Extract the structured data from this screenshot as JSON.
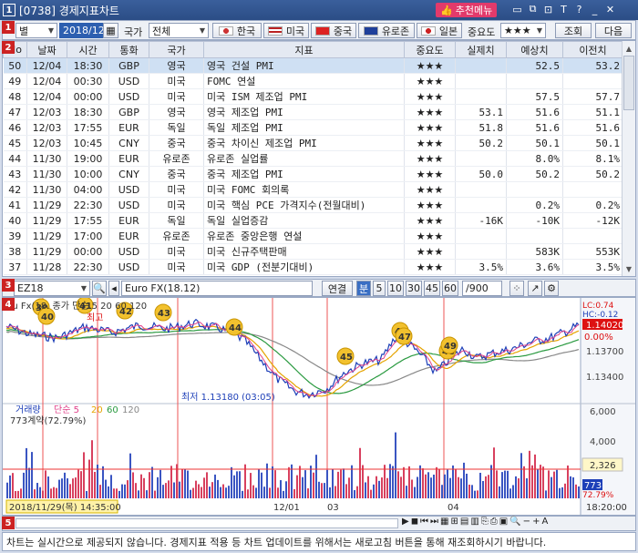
{
  "window": {
    "number": "1",
    "title": "[0738] 경제지표차트",
    "recommend_label": "추천메뉴",
    "icons": [
      "window-icon",
      "restore-icon",
      "pin-icon",
      "text-size-icon",
      "help-icon",
      "minimize-icon",
      "close-icon"
    ]
  },
  "toolbar": {
    "period_value": "별",
    "date_value": "2018/12/04",
    "country_label": "국가",
    "country_value": "전체",
    "countries": [
      {
        "label": "한국",
        "icon": "korea-flag-icon"
      },
      {
        "label": "미국",
        "icon": "usa-flag-icon"
      },
      {
        "label": "중국",
        "icon": "china-flag-icon"
      },
      {
        "label": "유로존",
        "icon": "eu-flag-icon"
      },
      {
        "label": "일본",
        "icon": "japan-flag-icon"
      }
    ],
    "importance_label": "중요도",
    "importance_value": "★★★",
    "search_label": "조회",
    "next_label": "다음"
  },
  "section_badges": [
    "1",
    "2",
    "3",
    "4",
    "5"
  ],
  "table": {
    "columns": [
      "No",
      "날짜",
      "시간",
      "통화",
      "국가",
      "지표",
      "중요도",
      "실제치",
      "예상치",
      "이전치"
    ],
    "rows": [
      [
        "50",
        "12/04",
        "18:30",
        "GBP",
        "영국",
        "영국 건설 PMI",
        "★★★",
        "",
        "52.5",
        "53.2"
      ],
      [
        "49",
        "12/04",
        "00:30",
        "USD",
        "미국",
        "FOMC 연설",
        "★★★",
        "",
        "",
        ""
      ],
      [
        "48",
        "12/04",
        "00:00",
        "USD",
        "미국",
        "미국 ISM 제조업 PMI",
        "★★★",
        "",
        "57.5",
        "57.7"
      ],
      [
        "47",
        "12/03",
        "18:30",
        "GBP",
        "영국",
        "영국 제조업 PMI",
        "★★★",
        "53.1",
        "51.6",
        "51.1"
      ],
      [
        "46",
        "12/03",
        "17:55",
        "EUR",
        "독일",
        "독일 제조업 PMI",
        "★★★",
        "51.8",
        "51.6",
        "51.6"
      ],
      [
        "45",
        "12/03",
        "10:45",
        "CNY",
        "중국",
        "중국 차이신 제조업 PMI",
        "★★★",
        "50.2",
        "50.1",
        "50.1"
      ],
      [
        "44",
        "11/30",
        "19:00",
        "EUR",
        "유로존",
        "유로존 실업률",
        "★★★",
        "",
        "8.0%",
        "8.1%"
      ],
      [
        "43",
        "11/30",
        "10:00",
        "CNY",
        "중국",
        "중국 제조업 PMI",
        "★★★",
        "50.0",
        "50.2",
        "50.2"
      ],
      [
        "42",
        "11/30",
        "04:00",
        "USD",
        "미국",
        "미국 FOMC 회의록",
        "★★★",
        "",
        "",
        ""
      ],
      [
        "41",
        "11/29",
        "22:30",
        "USD",
        "미국",
        "미국 핵심 PCE 가격지수(전월대비)",
        "★★★",
        "",
        "0.2%",
        "0.2%"
      ],
      [
        "40",
        "11/29",
        "17:55",
        "EUR",
        "독일",
        "독일 실업증감",
        "★★★",
        "-16K",
        "-10K",
        "-12K"
      ],
      [
        "39",
        "11/29",
        "17:00",
        "EUR",
        "유로존",
        "유로존 중앙은행 연설",
        "★★★",
        "",
        "",
        ""
      ],
      [
        "38",
        "11/29",
        "00:00",
        "USD",
        "미국",
        "미국 신규주택판매",
        "★★★",
        "",
        "583K",
        "553K"
      ],
      [
        "37",
        "11/28",
        "22:30",
        "USD",
        "미국",
        "미국 GDP (전분기대비)",
        "★★★",
        "3.5%",
        "3.6%",
        "3.5%"
      ]
    ]
  },
  "chartbar": {
    "code_value": "EZ18",
    "name_value": "Euro FX(18.12)",
    "link_label": "연결",
    "period_tabs": [
      "분",
      "5",
      "10",
      "30",
      "45",
      "60"
    ],
    "count_value": "/900"
  },
  "chart": {
    "price_legend": "Eu   Fx(18.   종가  단순 5   20  60  120",
    "low_label": "최저 1.13180 (03:05)",
    "high_label": "최고",
    "lc_label": "LC:0.74",
    "hc_label": "HC:-0.12",
    "current_price": "1.14020",
    "current_pct": "0.00%",
    "price_ticks": [
      "1.13700",
      "1.13400"
    ],
    "volume_legend": [
      "거래량",
      "단순 5",
      "20",
      "60",
      "120"
    ],
    "volume_sub": "773계약(72.79%)",
    "volume_ticks": [
      "6,000",
      "4,000",
      "2,000"
    ],
    "volume_marker": "2,326",
    "volume_current": "773",
    "volume_current_pct": "72.79%",
    "x_labels": [
      "12/01",
      "03",
      "04"
    ],
    "cursor_label": "2018/11/29(목) 14:35:00",
    "time_label": "18:20:00",
    "event_markers": [
      "39",
      "40",
      "41",
      "42",
      "43",
      "44",
      "45",
      "46",
      "47",
      "48",
      "49"
    ]
  },
  "notice": "차트는 실시간으로 제공되지 않습니다. 경제지표 적용 등 차트 업데이트를 위해서는 새로고침 버튼을 통해 재조회하시기 바랍니다."
}
